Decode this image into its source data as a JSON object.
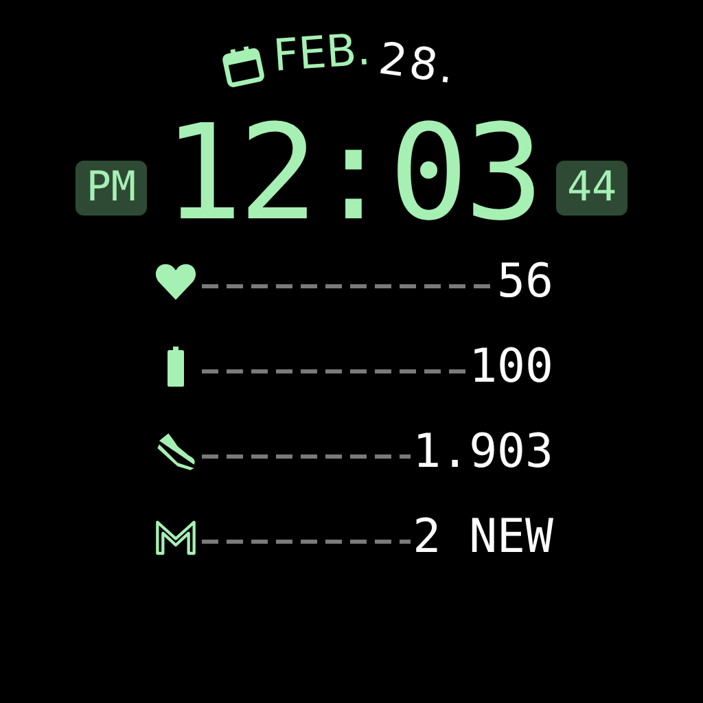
{
  "date": {
    "month": "FEB.",
    "day": "28."
  },
  "time": {
    "period": "PM",
    "clock": "12:03",
    "seconds": "44"
  },
  "stats": [
    {
      "kind": "heart",
      "value": "56"
    },
    {
      "kind": "battery",
      "value": "100"
    },
    {
      "kind": "steps",
      "value": "1.903"
    },
    {
      "kind": "mail",
      "value": "2 NEW"
    }
  ]
}
